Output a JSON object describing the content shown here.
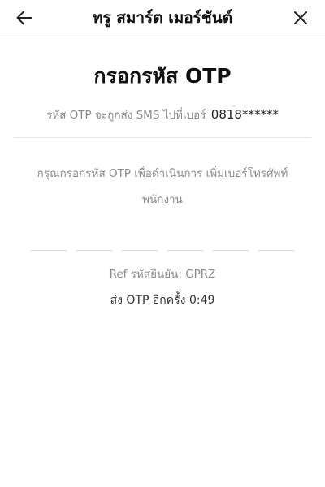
{
  "header": {
    "title": "ทรู สมาร์ต เมอร์ชันต์",
    "back_icon": "arrow-left-icon",
    "close_icon": "close-icon"
  },
  "main": {
    "title": "กรอกรหัส OTP",
    "sent_text": "รหัส OTP จะถูกส่ง SMS ไปที่เบอร์",
    "phone_masked": "0818******",
    "instruction_line1": "กรุณกรอกรหัส OTP เพื่อดำเนินการ เพิ่มเบอร์โทรศัพท์",
    "instruction_line2": "พนักงาน",
    "otp_length": 6,
    "ref_label": "Ref รหัสยืนยัน:",
    "ref_code": "GPRZ",
    "resend_label": "ส่ง OTP อีกครั้ง",
    "resend_timer": "0:49"
  }
}
